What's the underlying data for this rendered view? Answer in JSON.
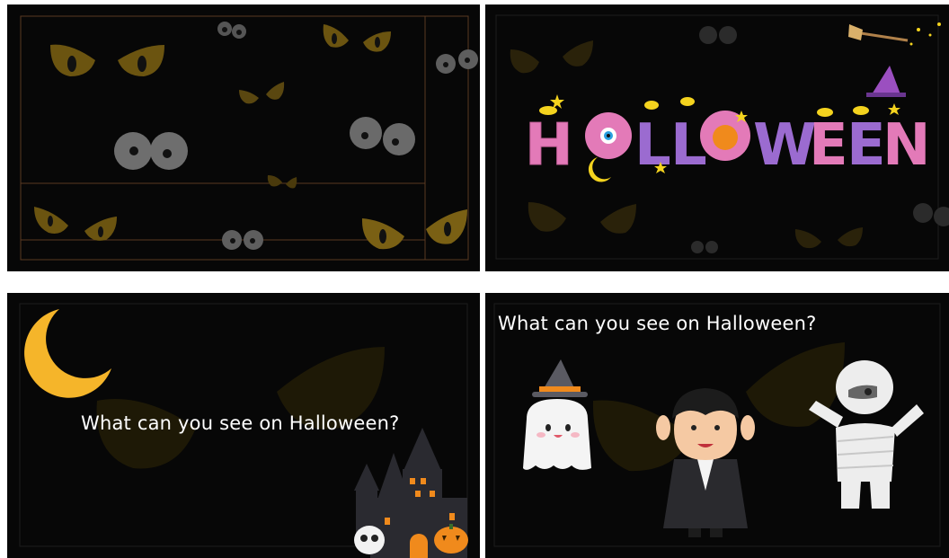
{
  "slides": [
    {
      "label": ""
    },
    {
      "label": "",
      "title_art": "HALLOWEEN"
    },
    {
      "caption": "What can you see on Halloween?"
    },
    {
      "caption": "What can you see on Halloween?"
    }
  ],
  "colors": {
    "background": "#070707",
    "eye_yellow": "#c9a01b",
    "eye_dim": "#4a3b0a",
    "eye_grey": "#7a7a7a",
    "title_pink": "#e37ab8",
    "title_purple": "#9b6bd0",
    "moon": "#f5b52a",
    "pumpkin": "#f08a1c"
  }
}
